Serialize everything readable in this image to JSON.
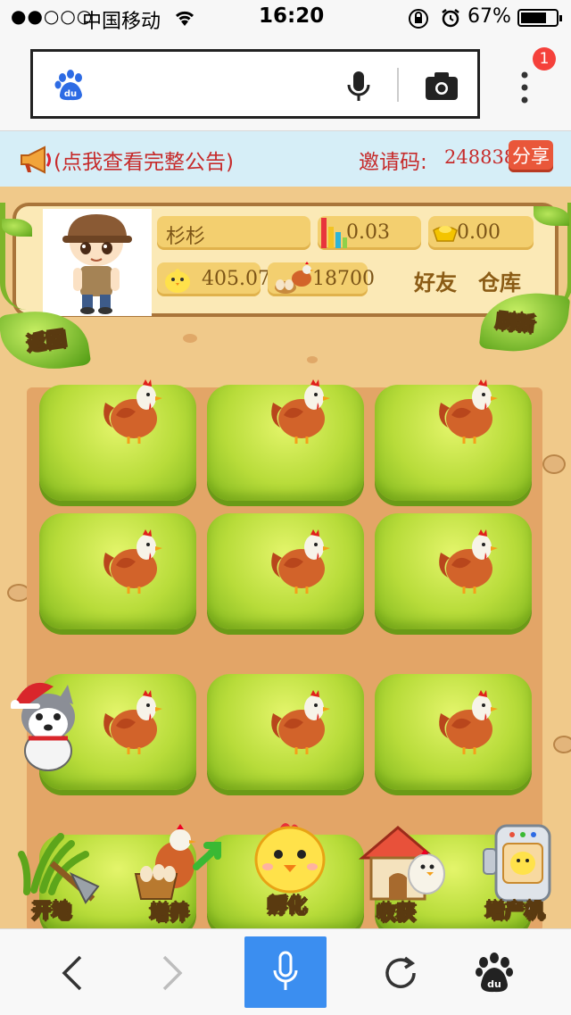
{
  "status": {
    "signal": "●●○○○",
    "carrier": "中国移动",
    "time": "16:20",
    "battery": "67%"
  },
  "browser": {
    "logo": "du",
    "badge_count": "1",
    "icons": [
      "baidu-paw-icon",
      "microphone-icon",
      "camera-icon",
      "more-vertical-icon"
    ]
  },
  "notice": {
    "announcement": "(点我查看完整公告)",
    "invite_label": "邀请码:",
    "invite_code": "248838",
    "share_label": "分享"
  },
  "profile": {
    "name": "杉杉",
    "stat_bars_value": "0.03",
    "gold_value": "0.00",
    "chick_value": "405.07",
    "hen_value": "18700",
    "friends_label": "好友",
    "warehouse_label": "仓库",
    "back_label": "返回",
    "refresh_label": "刷新"
  },
  "toolbar": {
    "open_land": "开地",
    "raise": "增养",
    "hatch": "孵化",
    "harvest": "收获",
    "boost_machine": "增产机"
  },
  "colors": {
    "notice_bg": "#d6eef7",
    "notice_text": "#c62a2a",
    "pill_bg": "#f3cf6f",
    "ground": "#f0c98a",
    "grass": "#b8dc3a",
    "nav_accent": "#3b8ef0"
  }
}
